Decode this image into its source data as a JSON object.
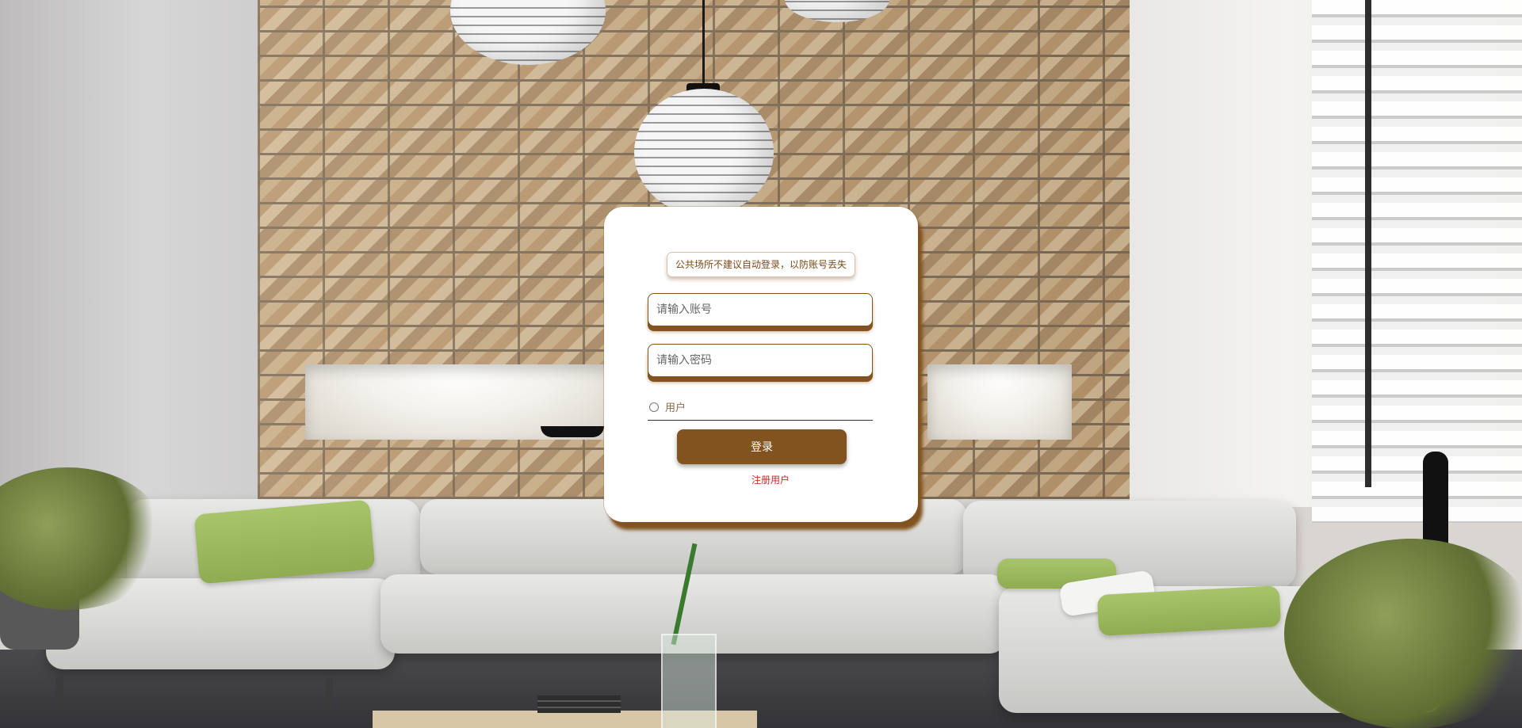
{
  "login": {
    "notice": "公共场所不建议自动登录，以防账号丢失",
    "account_placeholder": "请输入账号",
    "password_placeholder": "请输入密码",
    "role_option": "用户",
    "login_button": "登录",
    "register_link": "注册用户"
  },
  "colors": {
    "accent": "#80531f",
    "register_link": "#c62828",
    "card_background": "#ffffff"
  },
  "background": {
    "scene": "living-room-photo"
  }
}
